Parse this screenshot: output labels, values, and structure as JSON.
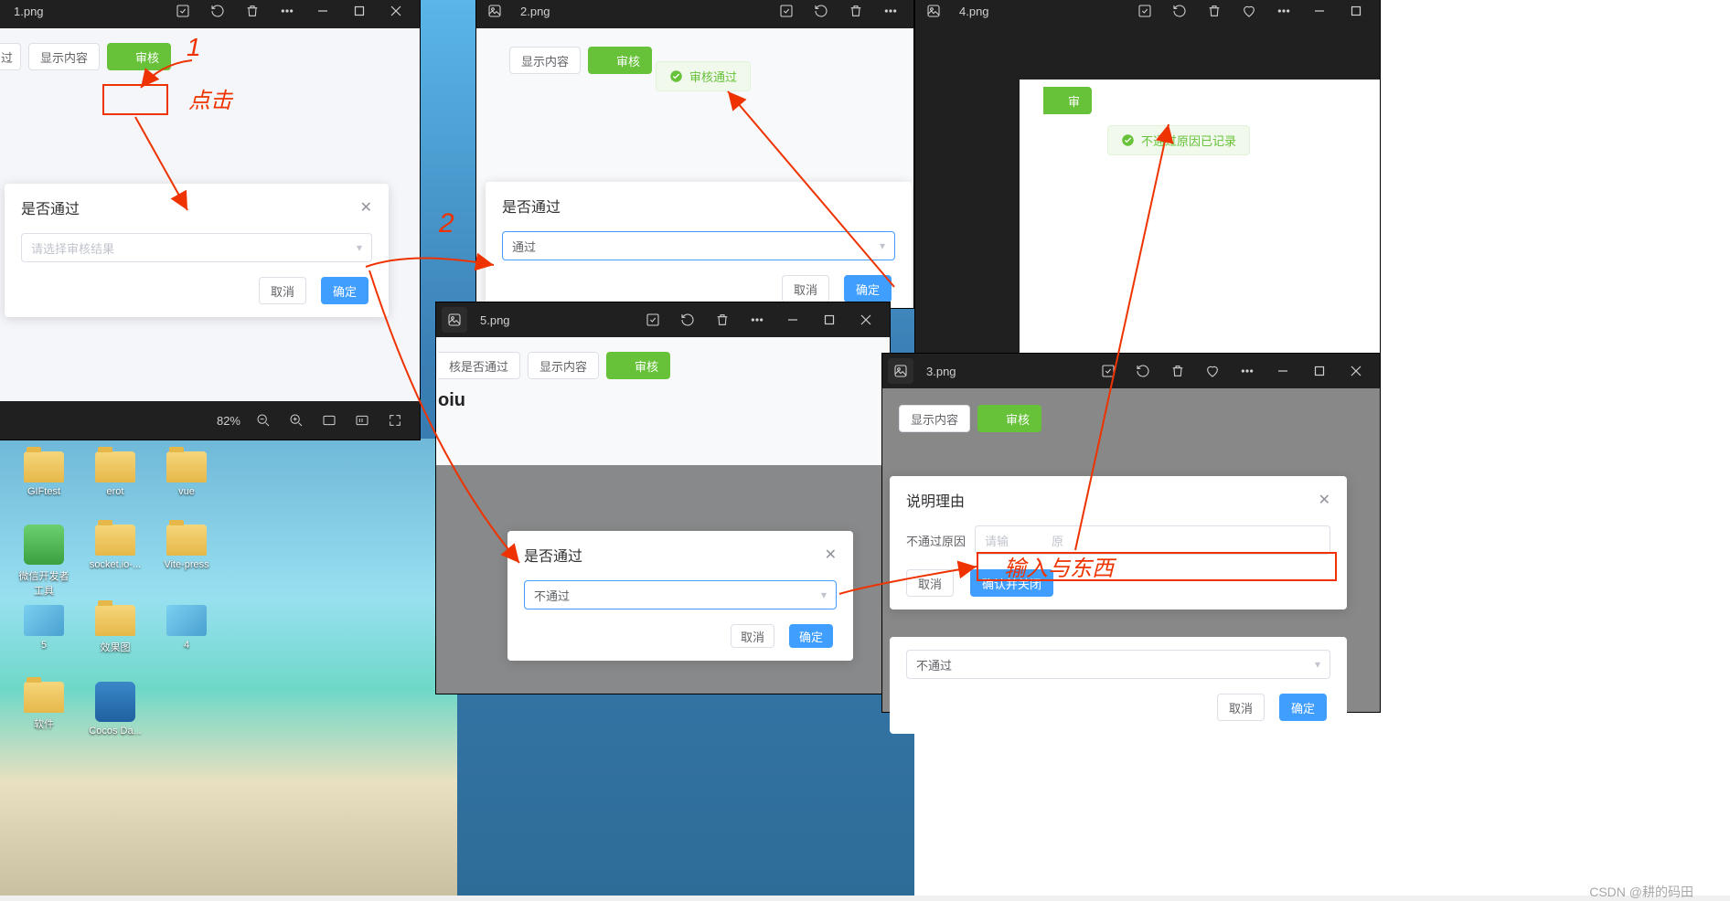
{
  "watermark": "CSDN @耕的码田",
  "annotations": {
    "step1": "1",
    "step2": "2",
    "click_label": "点击",
    "input_label": "输入与东西"
  },
  "toolbar": {
    "show_content": "显示内容",
    "audit": "审核",
    "audit_partial": "审",
    "audit_pass_clipped": "核是否通过",
    "oiu": "oiu"
  },
  "modal1": {
    "title": "是否通过",
    "placeholder": "请选择审核结果",
    "cancel": "取消",
    "ok": "确定"
  },
  "modal2": {
    "title": "是否通过",
    "value": "通过",
    "cancel": "取消",
    "ok": "确定"
  },
  "modal5": {
    "title": "是否通过",
    "value": "不通过",
    "cancel": "取消",
    "ok": "确定"
  },
  "modal3": {
    "title": "说明理由",
    "reason_label": "不通过原因",
    "input_placeholder_fragment": "请输",
    "input_placeholder_fragment2": "原",
    "cancel": "取消",
    "ok": "确认并关闭",
    "under_value": "不通过",
    "under_cancel": "取消",
    "under_ok": "确定"
  },
  "toast_pass": "审核通过",
  "toast_fail_reason": "不通过原因已记录",
  "win1": {
    "file": "1.png",
    "zoom": "82%"
  },
  "win2": {
    "file": "2.png"
  },
  "win4": {
    "file": "4.png"
  },
  "win5": {
    "file": "5.png"
  },
  "win3": {
    "file": "3.png"
  },
  "desktop": {
    "giftest": "GIFtest",
    "erot": "erot",
    "vue": "vue",
    "wxdev": "微信开发者工具",
    "socketio": "socket.io-...",
    "vitepress": "Vite-press",
    "five": "5",
    "effect": "效果图",
    "four": "4",
    "software": "软件",
    "cocos": "Cocos Da..."
  }
}
